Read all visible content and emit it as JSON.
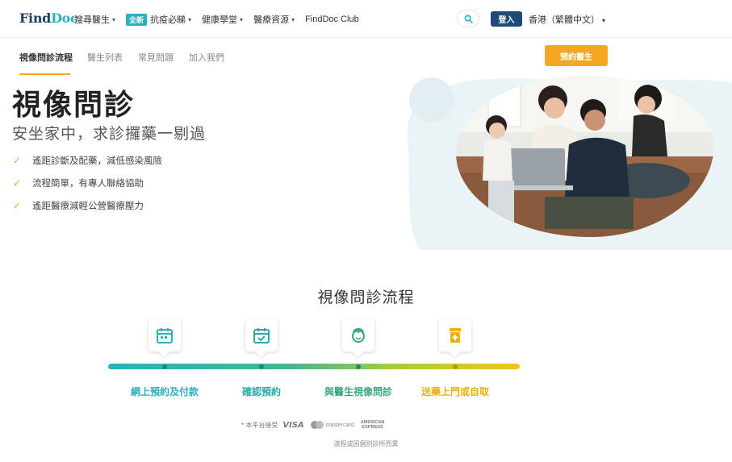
{
  "header": {
    "logo_find": "Find",
    "logo_doc": "Doc",
    "nav": [
      {
        "label": "搜尋醫生",
        "has_caret": true,
        "badge": ""
      },
      {
        "label": "抗疫必睇",
        "has_caret": true,
        "badge": "全新"
      },
      {
        "label": "健康學堂",
        "has_caret": true,
        "badge": ""
      },
      {
        "label": "醫療資源",
        "has_caret": true,
        "badge": ""
      },
      {
        "label": "FindDoc Club",
        "has_caret": false,
        "badge": ""
      }
    ],
    "search_icon": "search-icon",
    "login_label": "登入",
    "language": "香港（繁體中文）"
  },
  "subnav": {
    "tabs": [
      "視像問診流程",
      "醫生列表",
      "常見問題",
      "加入我們"
    ],
    "active_index": 0,
    "book_label": "預約醫生"
  },
  "hero": {
    "title": "視像問診",
    "subtitle": "安坐家中，求診攞藥一剔過",
    "features": [
      "遙距診斷及配藥，減低感染風險",
      "流程簡單，有專人聯絡協助",
      "遙距醫療減輕公營醫療壓力"
    ]
  },
  "process": {
    "title": "視像問診流程",
    "steps": [
      {
        "label": "網上預約及付款",
        "icon": "calendar-icon",
        "color": "#2bb1bd"
      },
      {
        "label": "確認預約",
        "icon": "calendar-check-icon",
        "color": "#2ba8a8"
      },
      {
        "label": "與醫生視像問診",
        "icon": "doctor-icon",
        "color": "#3aa97a"
      },
      {
        "label": "送藥上門或自取",
        "icon": "medicine-icon",
        "color": "#e7b20f"
      }
    ]
  },
  "payments": {
    "prefix": "* 本平台接受",
    "visa": "VISA",
    "mastercard": "mastercard",
    "amex_line1": "AMERICAN",
    "amex_line2": "EXPRESS"
  },
  "footer_note": "流程或因個別診所而異"
}
